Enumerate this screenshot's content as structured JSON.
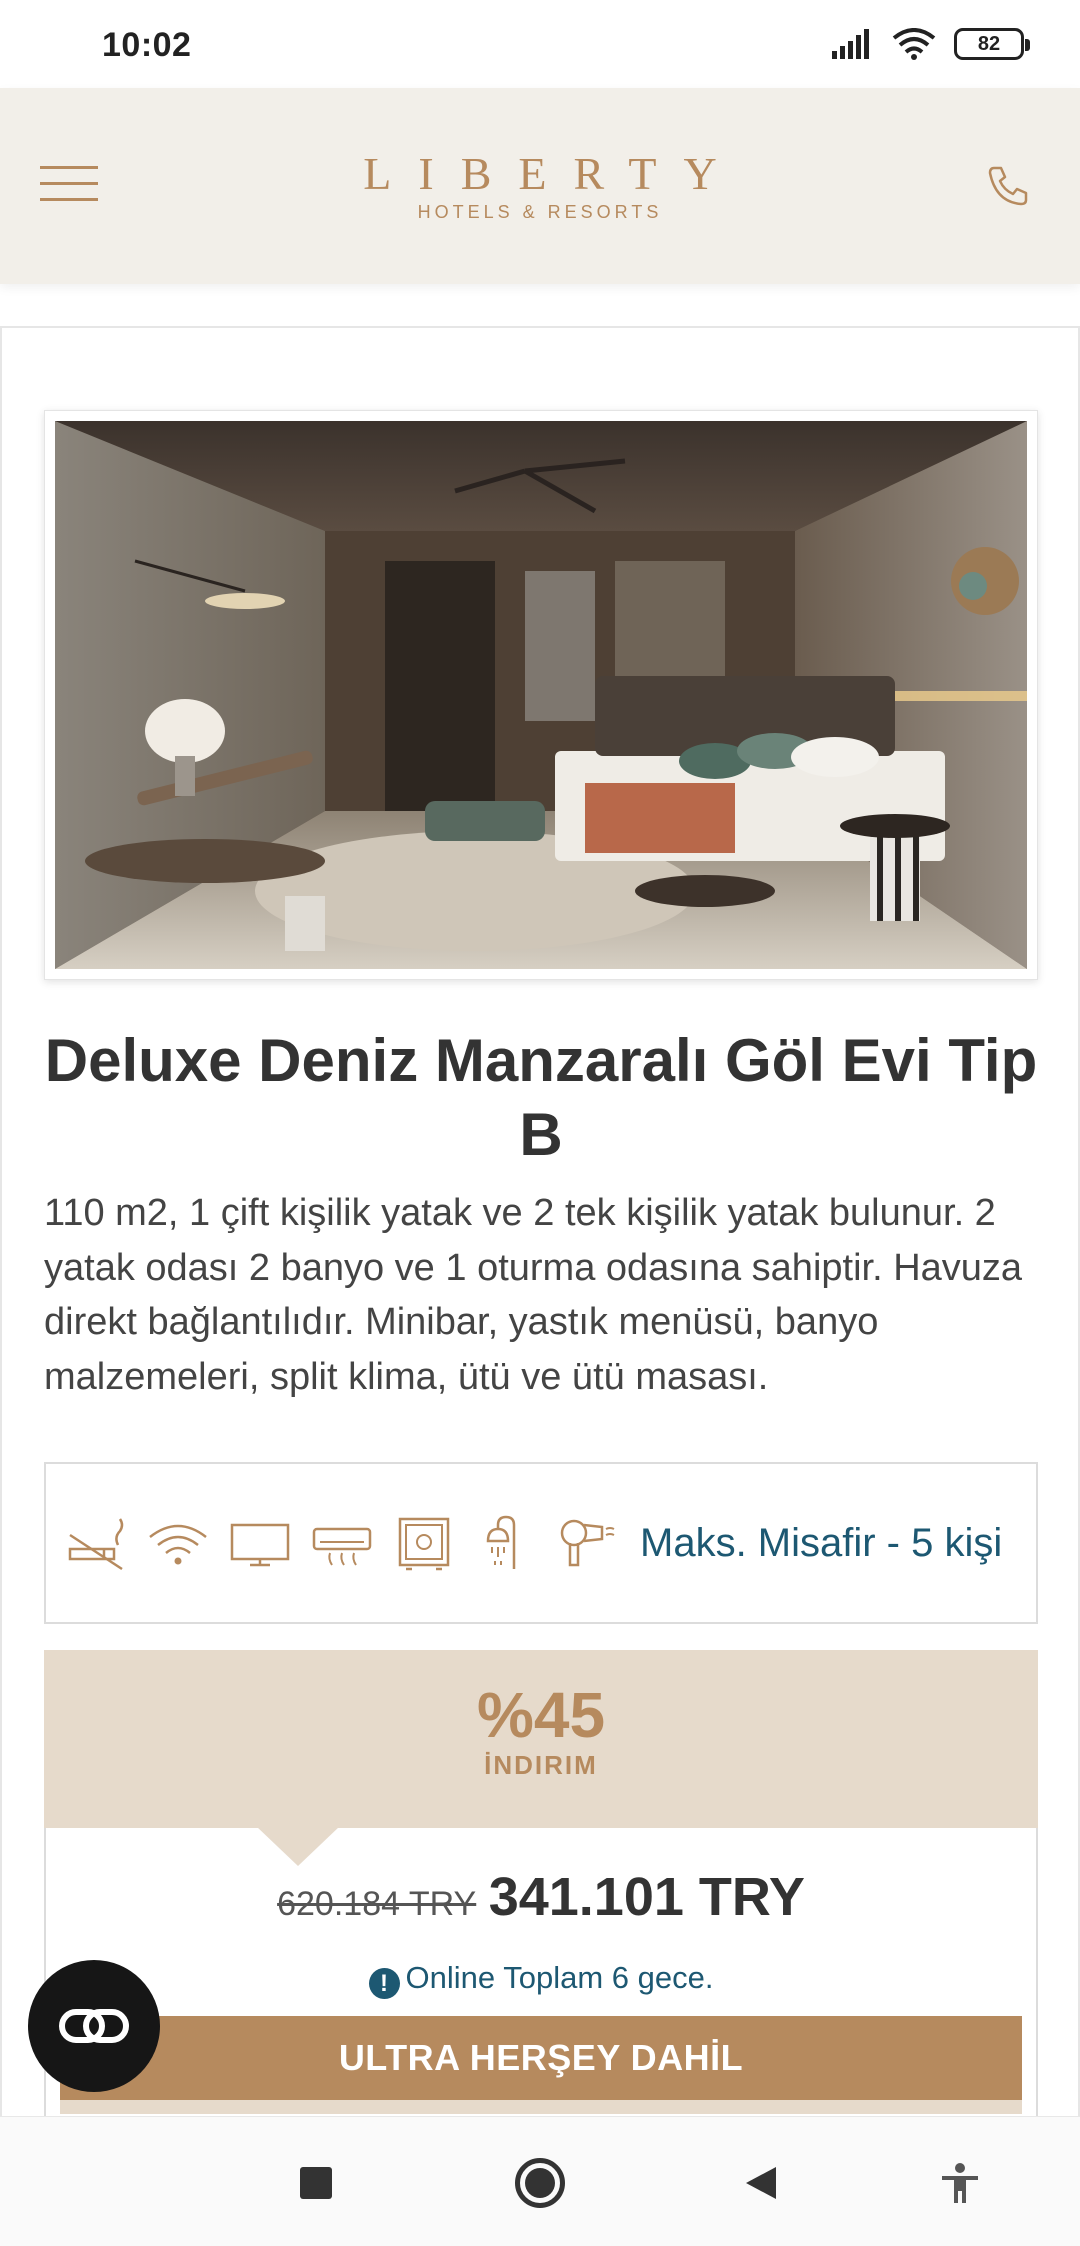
{
  "status_bar": {
    "time": "10:02",
    "battery": "82",
    "icons": [
      "signal-icon",
      "wifi-icon",
      "battery-icon"
    ]
  },
  "header": {
    "logo_main": "LIBERTY",
    "logo_sub": "HOTELS & RESORTS",
    "icons": [
      "menu-icon",
      "phone-icon"
    ]
  },
  "room": {
    "title": "Deluxe Deniz Manzaralı Göl Evi Tip B",
    "description": "110 m2, 1 çift kişilik yatak ve 2 tek kişilik yatak bulunur. 2 yatak odası 2 banyo ve 1 oturma odasına sahiptir. Havuza direkt bağlantılıdır. Minibar, yastık menüsü, banyo malzemeleri, split klima, ütü ve ütü masası.",
    "amenities": [
      "no-smoking-icon",
      "wifi-icon",
      "tv-icon",
      "air-conditioner-icon",
      "safe-icon",
      "shower-icon",
      "hair-dryer-icon"
    ],
    "max_guests": "Maks. Misafir - 5 kişi"
  },
  "pricing": {
    "discount_value": "%45",
    "discount_label": "İNDIRIM",
    "old_price": "620.184 TRY",
    "new_price": "341.101 TRY",
    "note": "Online Toplam 6 gece.",
    "board_type": "ULTRA HERŞEY DAHİL"
  },
  "colors": {
    "brand": "#b68a5e",
    "header_bg": "#f2efe9",
    "discount_bg": "#e6dacb",
    "link": "#1d5872"
  },
  "nav": {
    "icons": [
      "recents-square-icon",
      "home-circle-icon",
      "back-triangle-icon",
      "accessibility-icon"
    ]
  }
}
